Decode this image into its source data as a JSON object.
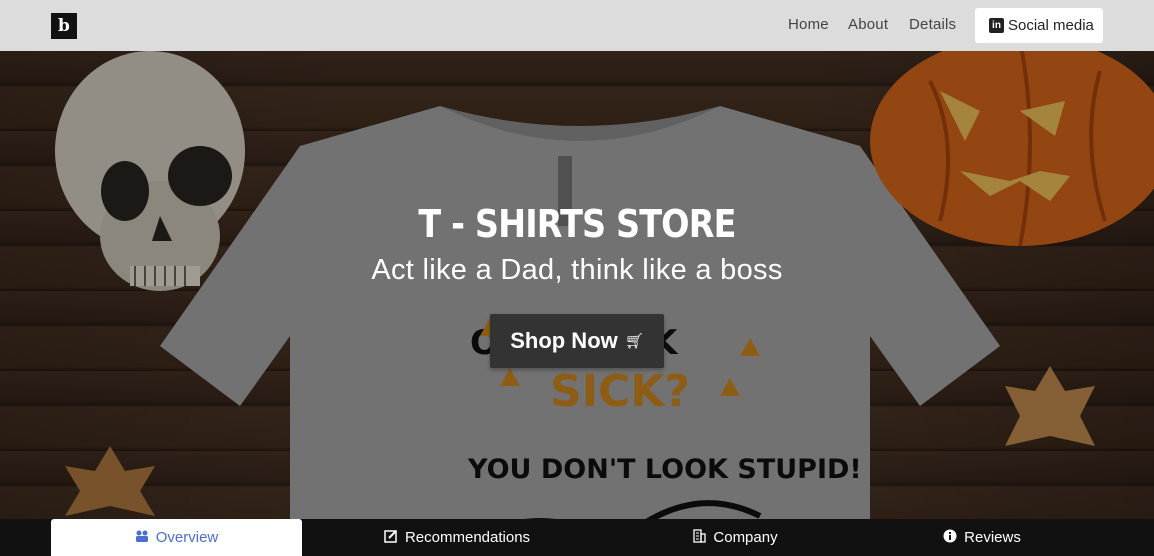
{
  "navbar": {
    "logo": "b",
    "links": [
      "Home",
      "About",
      "Details"
    ],
    "social_label": "Social media",
    "social_icon": "linkedin-icon"
  },
  "hero": {
    "title": "T - SHIRTS STORE",
    "subtitle": "Act like a Dad, think like a boss",
    "cta_label": "Shop Now",
    "cta_icon": "cart-icon"
  },
  "tabs": [
    {
      "label": "Overview",
      "icon": "users-icon",
      "active": true
    },
    {
      "label": "Recommendations",
      "icon": "edit-icon",
      "active": false
    },
    {
      "label": "Company",
      "icon": "building-icon",
      "active": false
    },
    {
      "label": "Reviews",
      "icon": "info-icon",
      "active": false
    }
  ],
  "colors": {
    "navbar_bg": "#dcdcdc",
    "tab_active_text": "#4a6fd0",
    "tabbar_bg": "#111111",
    "cta_bg": "#333333"
  }
}
